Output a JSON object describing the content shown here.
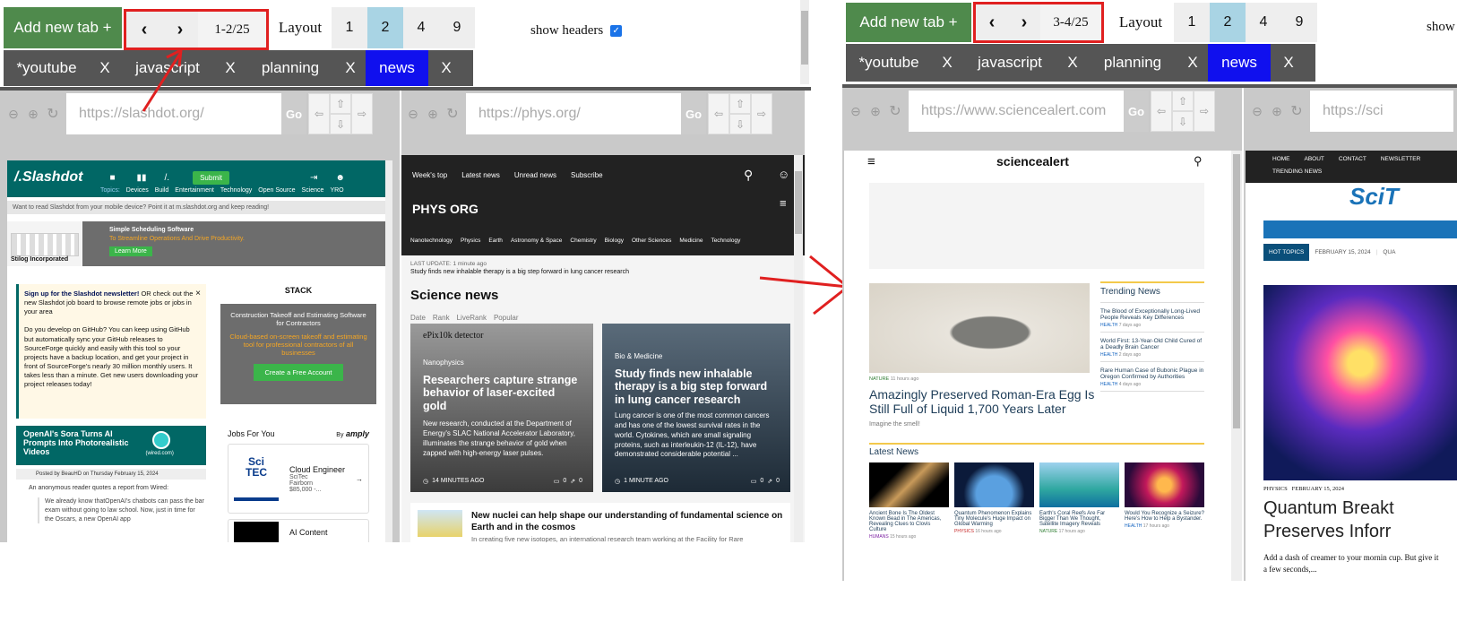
{
  "left": {
    "add_tab": "Add new tab +",
    "prev": "‹",
    "next": "›",
    "page_label": "1-2/25",
    "layout_label": "Layout",
    "layouts": [
      "1",
      "2",
      "4",
      "9"
    ],
    "show_headers": "show headers",
    "tabs": [
      "*youtube",
      "javascript",
      "planning",
      "news"
    ],
    "close": "X",
    "panes": [
      {
        "url": "https://slashdot.org/",
        "go": "Go"
      },
      {
        "url": "https://phys.org/",
        "go": "Go"
      }
    ]
  },
  "right": {
    "add_tab": "Add new tab +",
    "page_label": "3-4/25",
    "layout_label": "Layout",
    "layouts": [
      "1",
      "2",
      "4",
      "9"
    ],
    "show_headers": "show",
    "tabs": [
      "*youtube",
      "javascript",
      "planning",
      "news"
    ],
    "panes": [
      {
        "url": "https://www.sciencealert.com",
        "go": "Go"
      },
      {
        "url": "https://sci",
        "go": "Go"
      }
    ]
  },
  "slashdot": {
    "logo": "/.Slashdot",
    "submit": "Submit",
    "topics_label": "Topics:",
    "topics": [
      "Devices",
      "Build",
      "Entertainment",
      "Technology",
      "Open Source",
      "Science",
      "YRO"
    ],
    "mobile_note": "Want to read Slashdot from your mobile device? Point it at m.slashdot.org and keep reading!",
    "ad_company": "Stilog Incorporated",
    "ad_title": "Simple Scheduling Software",
    "ad_sub": "To Streamline Operations And Drive Productivity.",
    "ad_btn": "Learn More",
    "newsletter_title": "Sign up for the Slashdot newsletter!",
    "newsletter_rest": "OR check out the new Slashdot job board to browse remote jobs or jobs in your area",
    "github_note": "Do you develop on GitHub? You can keep using GitHub but automatically sync your GitHub releases to SourceForge quickly and easily with this tool so your projects have a backup location, and get your project in front of SourceForge's nearly 30 million monthly users. It takes less than a minute. Get new users downloading your project releases today!",
    "stack_brand": "STACK",
    "stack_title": "Construction Takeoff and Estimating Software for Contractors",
    "stack_sub": "Cloud-based on-screen takeoff and estimating tool for professional contractors of all businesses",
    "stack_btn": "Create a Free Account",
    "story_title": "OpenAI's Sora Turns AI Prompts Into Photorealistic Videos",
    "story_src": "(wired.com)",
    "posted": "Posted by BeauHD on Thursday February 15, 2024",
    "story_intro": "An anonymous reader quotes a report from Wired:",
    "story_body": "We already know thatOpenAI's chatbots can pass the bar exam without going to law school. Now, just in time for the Oscars, a new OpenAI app",
    "jobs_title": "Jobs For You",
    "jobs_by": "By",
    "jobs_brand": "amply",
    "job_title": "Cloud Engineer",
    "job_company": "SciTec",
    "job_location": "Fairborn",
    "job_salary": "$85,000 -...",
    "job2_title": "AI Content"
  },
  "phys": {
    "nav": [
      "Week's top",
      "Latest news",
      "Unread news",
      "Subscribe"
    ],
    "logo": "PHYS ORG",
    "cats": [
      "Nanotechnology",
      "Physics",
      "Earth",
      "Astronomy & Space",
      "Chemistry",
      "Biology",
      "Other Sciences",
      "Medicine",
      "Technology"
    ],
    "last_update": "LAST UPDATE: 1 minute ago",
    "last_update_title": "Study finds new inhalable therapy is a big step forward in lung cancer research",
    "section": "Science news",
    "filters": [
      "Date",
      "Rank",
      "LiveRank",
      "Popular"
    ],
    "card1_img_label": "ePix10k detector",
    "card1_cat": "Nanophysics",
    "card1_title": "Researchers capture strange behavior of laser-excited gold",
    "card1_body": "New research, conducted at the Department of Energy's SLAC National Accelerator Laboratory, illuminates the strange behavior of gold when zapped with high-energy laser pulses.",
    "card1_time": "14 MINUTES AGO",
    "card1_c": "0",
    "card1_s": "0",
    "card2_cat": "Bio & Medicine",
    "card2_title": "Study finds new inhalable therapy is a big step forward in lung cancer research",
    "card2_body": "Lung cancer is one of the most common cancers and has one of the lowest survival rates in the world. Cytokines, which are small signaling proteins, such as interleukin-12 (IL-12), have demonstrated considerable potential ...",
    "card2_time": "1 MINUTE AGO",
    "card2_c": "0",
    "card2_s": "0",
    "row_title": "New nuclei can help shape our understanding of fundamental science on Earth and in the cosmos",
    "row_body": "In creating five new isotopes, an international research team working at the Facility for Rare"
  },
  "sa": {
    "logo": "sciencealert",
    "hero_tag": "NATURE",
    "hero_time": "11 hours ago",
    "hero_title": "Amazingly Preserved Roman-Era Egg Is Still Full of Liquid 1,700 Years Later",
    "hero_sub": "Imagine the smell!",
    "trending_title": "Trending News",
    "trending": [
      {
        "title": "The Blood of Exceptionally Long-Lived People Reveals Key Differences",
        "tag": "HEALTH",
        "time": "7 days ago"
      },
      {
        "title": "World First: 13-Year-Old Child Cured of a Deadly Brain Cancer",
        "tag": "HEALTH",
        "time": "2 days ago"
      },
      {
        "title": "Rare Human Case of Bubonic Plague in Oregon Confirmed by Authorities",
        "tag": "HEALTH",
        "time": "4 days ago"
      }
    ],
    "latest_title": "Latest News",
    "latest": [
      {
        "title": "Ancient Bone Is The Oldest Known Bead in The Americas, Revealing Clues to Clovis Culture",
        "tag": "HUMANS",
        "time": "15 hours ago"
      },
      {
        "title": "Quantum Phenomenon Explains Tiny Molecule's Huge Impact on Global Warming",
        "tag": "PHYSICS",
        "time": "16 hours ago"
      },
      {
        "title": "Earth's Coral Reefs Are Far Bigger Than We Thought, Satellite Imagery Reveals",
        "tag": "NATURE",
        "time": "17 hours ago"
      },
      {
        "title": "Would You Recognize a Seizure? Here's How to Help a Bystander.",
        "tag": "HEALTH",
        "time": "17 hours ago"
      }
    ]
  },
  "scitech": {
    "nav": [
      "HOME",
      "ABOUT",
      "CONTACT",
      "NEWSLETTER",
      "TRENDING NEWS"
    ],
    "logo": "SciT",
    "hot": "HOT TOPICS",
    "date": "FEBRUARY 15, 2024",
    "date_tail": "QUA",
    "tag": "PHYSICS",
    "tag_date": "FEBRUARY 15, 2024",
    "title": "Quantum Breakt Preserves Inforr",
    "body": "Add a dash of creamer to your mornin cup. But give it a few seconds,..."
  },
  "colors": {
    "accent_green": "#4f8a4c",
    "active_tab": "#1010ee",
    "highlight_red": "#e02020",
    "layout_active": "#a9d4e4"
  }
}
